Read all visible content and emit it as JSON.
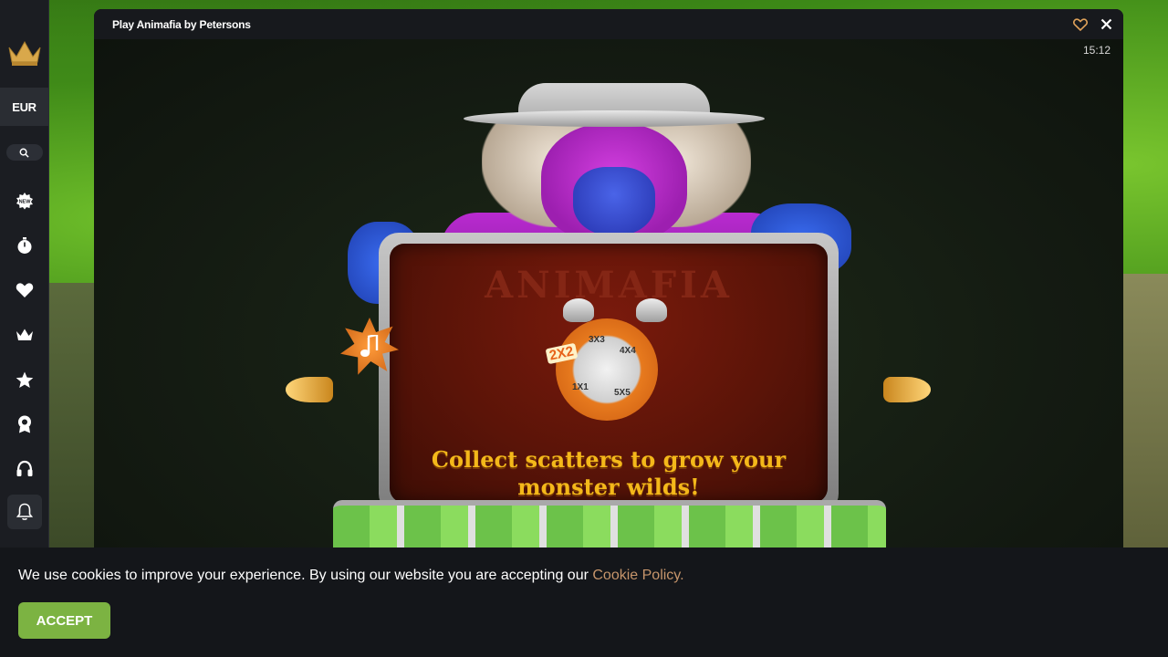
{
  "game": {
    "title": "Play Animafia by Petersons",
    "clock": "15:12",
    "brand": "ANIMAFIA",
    "caption_line1": "Collect scatters to grow your",
    "caption_line2": "monster wilds!",
    "dial": {
      "label_2x2": "2X2",
      "label_3x3": "3X3",
      "label_4x4": "4X4",
      "label_5x5": "5X5",
      "label_1x1": "1X1"
    }
  },
  "sidebar": {
    "currency": "EUR",
    "icons": [
      "crown-logo-icon",
      "search-icon",
      "new-badge-icon",
      "stopwatch-icon",
      "heart-icon",
      "crown-icon",
      "star-icon",
      "award-icon",
      "headset-icon",
      "bell-icon"
    ]
  },
  "header": {
    "icons": [
      "heart-outline-icon",
      "close-icon"
    ]
  },
  "cookie": {
    "text": "We use cookies to improve your experience. By using our website you are accepting our",
    "link": "Cookie Policy.",
    "accept": "ACCEPT"
  },
  "colors": {
    "accent": "#7cb342",
    "link": "#c6956b",
    "gold": "#f4b81a"
  }
}
